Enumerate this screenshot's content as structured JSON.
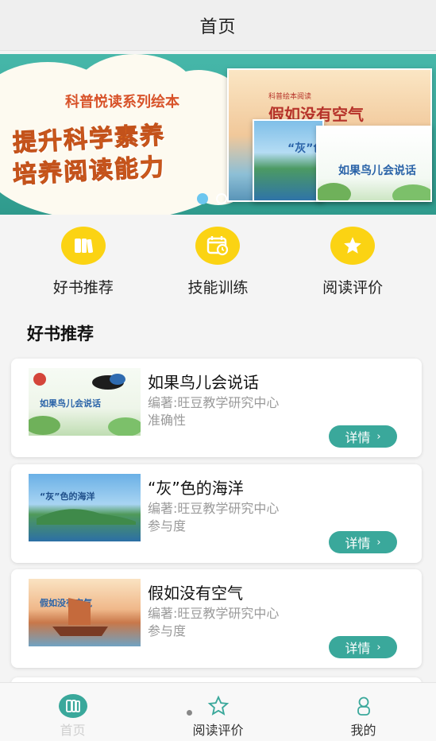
{
  "header": {
    "title": "首页"
  },
  "banner": {
    "series": "科普悦读系列绘本",
    "slogan_line1": "提升科学素养",
    "slogan_line2": "培养阅读能力",
    "covers": {
      "air": {
        "title": "假如没有空气",
        "subtitle": "科普绘本阅读"
      },
      "ocean": {
        "title": "“灰”色"
      },
      "bird": {
        "title": "如果鸟儿会说话"
      }
    }
  },
  "quick_nav": [
    {
      "label": "好书推荐",
      "icon": "book-icon"
    },
    {
      "label": "技能训练",
      "icon": "calendar-clock-icon"
    },
    {
      "label": "阅读评价",
      "icon": "star-icon"
    }
  ],
  "section": {
    "title": "好书推荐"
  },
  "books": [
    {
      "title": "如果鸟儿会说话",
      "author": "编著:旺豆教学研究中心",
      "tag": "准确性",
      "detail_label": "详情",
      "thumb_text": "如果鸟儿会说话"
    },
    {
      "title": "“灰”色的海洋",
      "author": "编著:旺豆教学研究中心",
      "tag": "参与度",
      "detail_label": "详情",
      "thumb_text": "“灰”色的海洋"
    },
    {
      "title": "假如没有空气",
      "author": "编著:旺豆教学研究中心",
      "tag": "参与度",
      "detail_label": "详情",
      "thumb_text": "假如没有空气"
    }
  ],
  "tabbar": {
    "tabs": [
      {
        "label": "首页",
        "icon": "home-book-icon",
        "active": true
      },
      {
        "label": "阅读评价",
        "icon": "star-outline-icon",
        "active": false
      },
      {
        "label": "我的",
        "icon": "user-icon",
        "active": false
      }
    ]
  },
  "colors": {
    "accent": "#3aa89b",
    "yellow": "#fbd313",
    "banner_bg": "#46b7a9"
  }
}
